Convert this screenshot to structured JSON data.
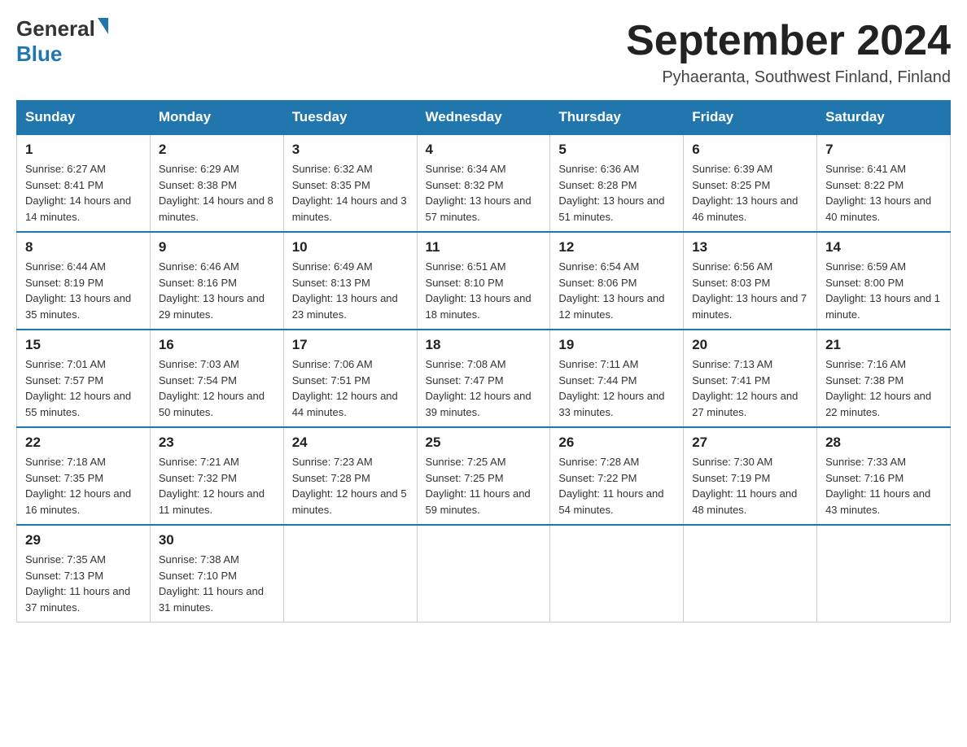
{
  "header": {
    "logo_general": "General",
    "logo_blue": "Blue",
    "title": "September 2024",
    "location": "Pyhaeranta, Southwest Finland, Finland"
  },
  "days_of_week": [
    "Sunday",
    "Monday",
    "Tuesday",
    "Wednesday",
    "Thursday",
    "Friday",
    "Saturday"
  ],
  "weeks": [
    [
      {
        "day": "1",
        "sunrise": "6:27 AM",
        "sunset": "8:41 PM",
        "daylight": "14 hours and 14 minutes."
      },
      {
        "day": "2",
        "sunrise": "6:29 AM",
        "sunset": "8:38 PM",
        "daylight": "14 hours and 8 minutes."
      },
      {
        "day": "3",
        "sunrise": "6:32 AM",
        "sunset": "8:35 PM",
        "daylight": "14 hours and 3 minutes."
      },
      {
        "day": "4",
        "sunrise": "6:34 AM",
        "sunset": "8:32 PM",
        "daylight": "13 hours and 57 minutes."
      },
      {
        "day": "5",
        "sunrise": "6:36 AM",
        "sunset": "8:28 PM",
        "daylight": "13 hours and 51 minutes."
      },
      {
        "day": "6",
        "sunrise": "6:39 AM",
        "sunset": "8:25 PM",
        "daylight": "13 hours and 46 minutes."
      },
      {
        "day": "7",
        "sunrise": "6:41 AM",
        "sunset": "8:22 PM",
        "daylight": "13 hours and 40 minutes."
      }
    ],
    [
      {
        "day": "8",
        "sunrise": "6:44 AM",
        "sunset": "8:19 PM",
        "daylight": "13 hours and 35 minutes."
      },
      {
        "day": "9",
        "sunrise": "6:46 AM",
        "sunset": "8:16 PM",
        "daylight": "13 hours and 29 minutes."
      },
      {
        "day": "10",
        "sunrise": "6:49 AM",
        "sunset": "8:13 PM",
        "daylight": "13 hours and 23 minutes."
      },
      {
        "day": "11",
        "sunrise": "6:51 AM",
        "sunset": "8:10 PM",
        "daylight": "13 hours and 18 minutes."
      },
      {
        "day": "12",
        "sunrise": "6:54 AM",
        "sunset": "8:06 PM",
        "daylight": "13 hours and 12 minutes."
      },
      {
        "day": "13",
        "sunrise": "6:56 AM",
        "sunset": "8:03 PM",
        "daylight": "13 hours and 7 minutes."
      },
      {
        "day": "14",
        "sunrise": "6:59 AM",
        "sunset": "8:00 PM",
        "daylight": "13 hours and 1 minute."
      }
    ],
    [
      {
        "day": "15",
        "sunrise": "7:01 AM",
        "sunset": "7:57 PM",
        "daylight": "12 hours and 55 minutes."
      },
      {
        "day": "16",
        "sunrise": "7:03 AM",
        "sunset": "7:54 PM",
        "daylight": "12 hours and 50 minutes."
      },
      {
        "day": "17",
        "sunrise": "7:06 AM",
        "sunset": "7:51 PM",
        "daylight": "12 hours and 44 minutes."
      },
      {
        "day": "18",
        "sunrise": "7:08 AM",
        "sunset": "7:47 PM",
        "daylight": "12 hours and 39 minutes."
      },
      {
        "day": "19",
        "sunrise": "7:11 AM",
        "sunset": "7:44 PM",
        "daylight": "12 hours and 33 minutes."
      },
      {
        "day": "20",
        "sunrise": "7:13 AM",
        "sunset": "7:41 PM",
        "daylight": "12 hours and 27 minutes."
      },
      {
        "day": "21",
        "sunrise": "7:16 AM",
        "sunset": "7:38 PM",
        "daylight": "12 hours and 22 minutes."
      }
    ],
    [
      {
        "day": "22",
        "sunrise": "7:18 AM",
        "sunset": "7:35 PM",
        "daylight": "12 hours and 16 minutes."
      },
      {
        "day": "23",
        "sunrise": "7:21 AM",
        "sunset": "7:32 PM",
        "daylight": "12 hours and 11 minutes."
      },
      {
        "day": "24",
        "sunrise": "7:23 AM",
        "sunset": "7:28 PM",
        "daylight": "12 hours and 5 minutes."
      },
      {
        "day": "25",
        "sunrise": "7:25 AM",
        "sunset": "7:25 PM",
        "daylight": "11 hours and 59 minutes."
      },
      {
        "day": "26",
        "sunrise": "7:28 AM",
        "sunset": "7:22 PM",
        "daylight": "11 hours and 54 minutes."
      },
      {
        "day": "27",
        "sunrise": "7:30 AM",
        "sunset": "7:19 PM",
        "daylight": "11 hours and 48 minutes."
      },
      {
        "day": "28",
        "sunrise": "7:33 AM",
        "sunset": "7:16 PM",
        "daylight": "11 hours and 43 minutes."
      }
    ],
    [
      {
        "day": "29",
        "sunrise": "7:35 AM",
        "sunset": "7:13 PM",
        "daylight": "11 hours and 37 minutes."
      },
      {
        "day": "30",
        "sunrise": "7:38 AM",
        "sunset": "7:10 PM",
        "daylight": "11 hours and 31 minutes."
      },
      null,
      null,
      null,
      null,
      null
    ]
  ]
}
